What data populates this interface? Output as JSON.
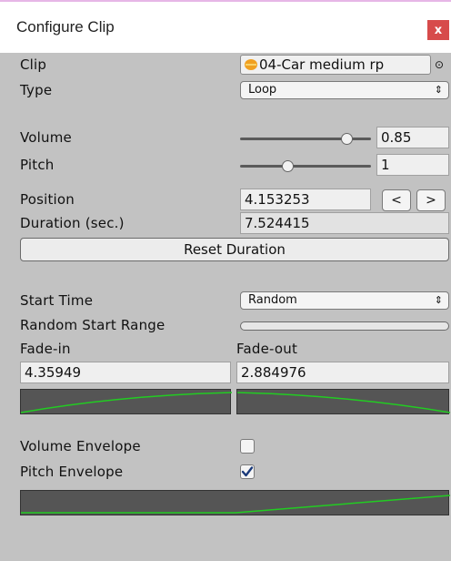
{
  "window": {
    "title": "Configure Clip",
    "close_label": "x"
  },
  "clip": {
    "label": "Clip",
    "value": "04-Car medium rp",
    "icon": "audio-clip-icon",
    "picker_glyph": "⊙"
  },
  "type": {
    "label": "Type",
    "value": "Loop",
    "arrows": "⇕"
  },
  "volume": {
    "label": "Volume",
    "value": "0.85",
    "level": 0.85
  },
  "pitch": {
    "label": "Pitch",
    "value": "1",
    "level": 0.35
  },
  "position": {
    "label": "Position",
    "value": "4.153253",
    "prev_label": "<",
    "next_label": ">"
  },
  "duration": {
    "label": "Duration (sec.)",
    "value": "7.524415"
  },
  "reset_duration": {
    "label": "Reset Duration"
  },
  "start_time": {
    "label": "Start Time",
    "value": "Random",
    "arrows": "⇕"
  },
  "random_start_range": {
    "label": "Random Start Range"
  },
  "fade_in": {
    "label": "Fade-in",
    "value": "4.35949"
  },
  "fade_out": {
    "label": "Fade-out",
    "value": "2.884976"
  },
  "volume_envelope": {
    "label": "Volume Envelope",
    "checked": false
  },
  "pitch_envelope": {
    "label": "Pitch Envelope",
    "checked": true
  },
  "colors": {
    "curve_line": "#22cc22",
    "curve_bg": "#555555",
    "close_bg": "#d74b4b"
  }
}
